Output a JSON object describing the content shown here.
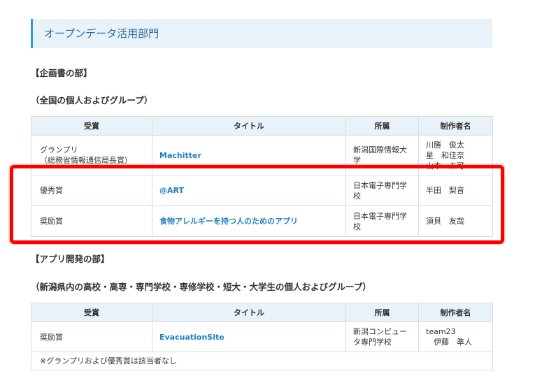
{
  "section_title": "オープンデータ活用部門",
  "planning": {
    "heading": "【企画書の部】",
    "subheading": "（全国の個人およびグループ）",
    "headers": [
      "受賞",
      "タイトル",
      "所属",
      "制作者名"
    ],
    "rows": [
      {
        "award": "グランプリ\n（総務省情報通信局長賞）",
        "title": "Machitter",
        "affiliation": "新潟国際情報大\n学",
        "authors": "川勝　俊太\n星　和佳奈\n山本　未可"
      },
      {
        "award": "優秀賞",
        "title": "@ART",
        "affiliation": "日本電子専門学\n校",
        "authors": "半田　梨音"
      },
      {
        "award": "奨励賞",
        "title": "食物アレルギーを持つ人のためのアプリ",
        "affiliation": "日本電子専門学\n校",
        "authors": "須貝　友哉"
      }
    ]
  },
  "app_dev": {
    "heading": "【アプリ開発の部】",
    "subheading": "（新潟県内の高校・高専・専門学校・専修学校・短大・大学生の個人およびグループ）",
    "headers": [
      "受賞",
      "タイトル",
      "所属",
      "制作者名"
    ],
    "rows": [
      {
        "award": "奨励賞",
        "title": "EvacuationSite",
        "affiliation": "新潟コンピュー\nタ専門学校",
        "authors": "team23\n　伊藤　準人"
      }
    ],
    "note": "※グランプリおよび優秀賞は該当者なし"
  },
  "highlight_color": "#ff0000",
  "accent_color": "#2a9fd0",
  "link_color": "#1f7fc0"
}
